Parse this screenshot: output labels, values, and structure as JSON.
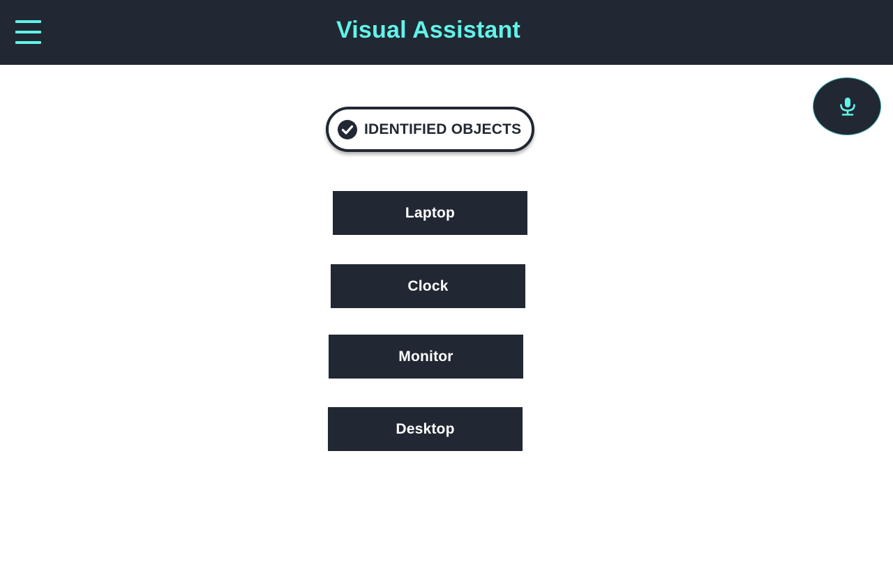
{
  "header": {
    "menu_icon": "hamburger-menu-icon",
    "title": "Visual Assistant"
  },
  "mic": {
    "icon": "microphone-icon"
  },
  "identified": {
    "icon": "check-circle-icon",
    "label": "IDENTIFIED OBJECTS"
  },
  "objects": [
    "Laptop",
    "Clock",
    "Monitor",
    "Desktop"
  ],
  "colors": {
    "header_bg": "#212833",
    "accent": "#62f3e8",
    "button_bg": "#212833",
    "button_text": "#ffffff",
    "page_bg": "#ffffff"
  }
}
